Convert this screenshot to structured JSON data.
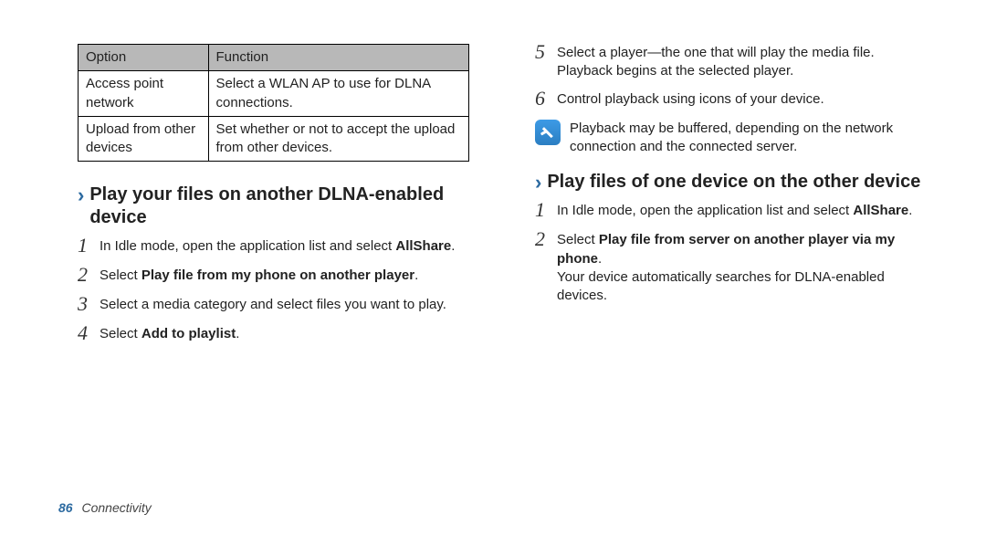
{
  "colA": {
    "table": {
      "header": {
        "c1": "Option",
        "c2": "Function"
      },
      "rows": [
        {
          "c1": "Access point network",
          "c2": "Select a WLAN AP to use for DLNA connections."
        },
        {
          "c1": "Upload from other devices",
          "c2": "Set whether or not to accept the upload from other devices."
        }
      ]
    },
    "section": {
      "title": "Play your files on another DLNA-enabled device",
      "steps": [
        {
          "n": "1",
          "pre": "In Idle mode, open the application list and select ",
          "bold": "AllShare",
          "post": "."
        },
        {
          "n": "2",
          "pre": "Select ",
          "bold": "Play file from my phone on another player",
          "post": "."
        },
        {
          "n": "3",
          "pre": "Select a media category and select files you want to play.",
          "bold": "",
          "post": ""
        },
        {
          "n": "4",
          "pre": "Select ",
          "bold": "Add to playlist",
          "post": "."
        }
      ]
    }
  },
  "colB": {
    "steps_top": [
      {
        "n": "5",
        "text": "Select a player—the one that will play the media file. Playback begins at the selected player."
      },
      {
        "n": "6",
        "text": "Control playback using icons of your device."
      }
    ],
    "note": "Playback may be buffered, depending on the network connection and the connected server.",
    "section": {
      "title": "Play files of one device on the other device",
      "steps": [
        {
          "n": "1",
          "pre": "In Idle mode, open the application list and select ",
          "bold": "AllShare",
          "post": "."
        },
        {
          "n": "2",
          "pre": "Select ",
          "bold": "Play file from server on another player via my phone",
          "post": ".",
          "after": "Your device automatically searches for DLNA-enabled devices."
        }
      ]
    }
  },
  "footer": {
    "page_number": "86",
    "section_name": "Connectivity"
  }
}
